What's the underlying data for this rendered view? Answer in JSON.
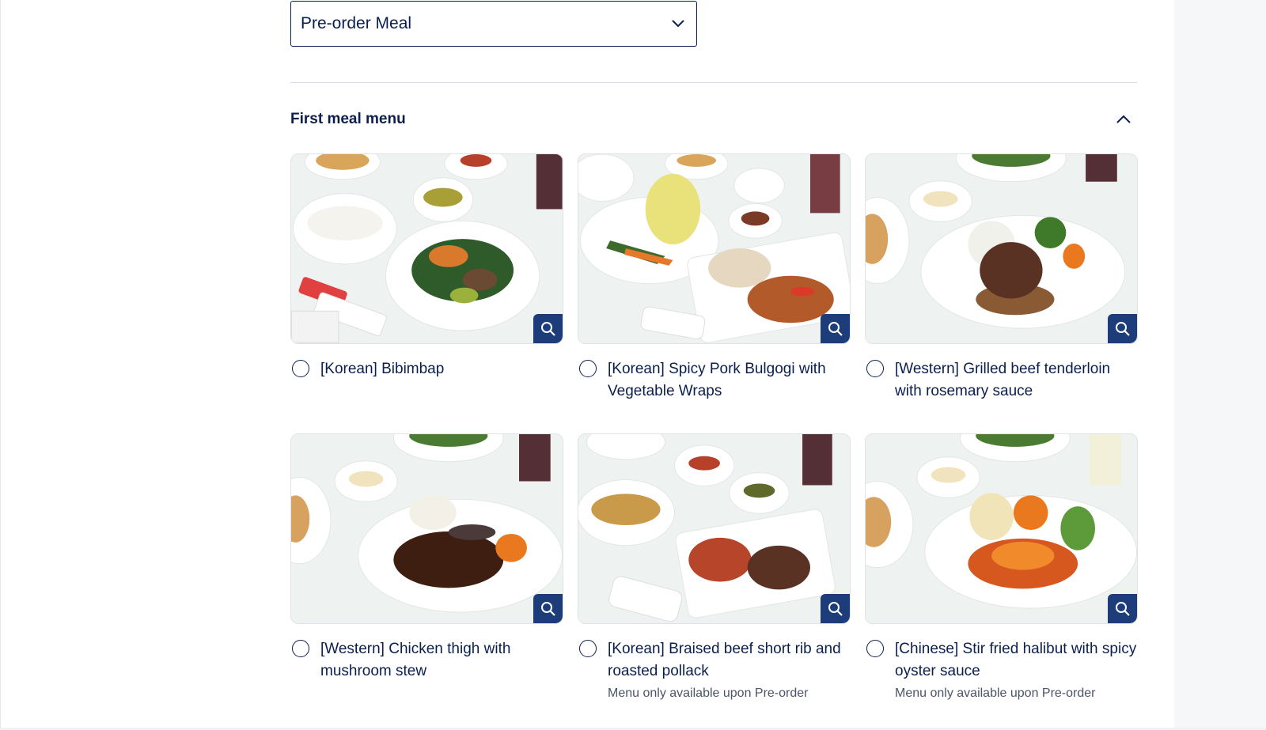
{
  "meal_select": {
    "value": "Pre-order Meal",
    "icon": "chevron-down-icon"
  },
  "section": {
    "title": "First meal menu",
    "icon": "chevron-up-icon"
  },
  "colors": {
    "navy": "#0b1f4d",
    "zoom_button": "#1c3d7a",
    "divider": "#d6d9df"
  },
  "menu_items": [
    {
      "label": "[Korean] Bibimbap",
      "note": ""
    },
    {
      "label": "[Korean] Spicy Pork Bulgogi with Vegetable Wraps",
      "note": ""
    },
    {
      "label": "[Western] Grilled beef tenderloin with rosemary sauce",
      "note": ""
    },
    {
      "label": "[Western] Chicken thigh with mushroom stew",
      "note": ""
    },
    {
      "label": "[Korean] Braised beef short rib and roasted pollack",
      "note": "Menu only available upon Pre-order"
    },
    {
      "label": "[Chinese] Stir fried halibut with spicy oyster sauce",
      "note": "Menu only available upon Pre-order"
    }
  ]
}
